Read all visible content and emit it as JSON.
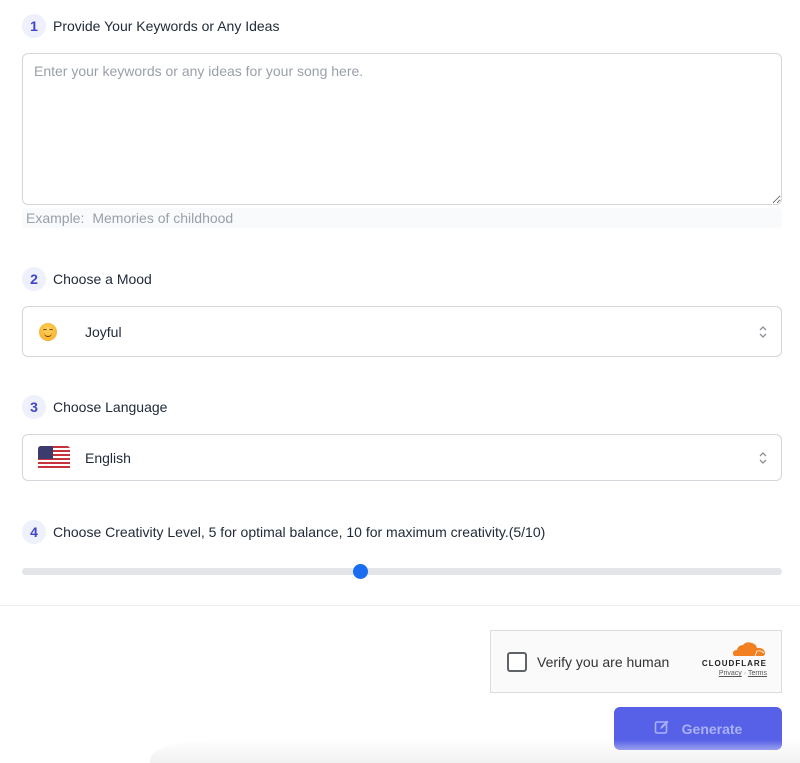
{
  "steps": [
    {
      "number": "1",
      "label": "Provide Your Keywords or Any Ideas"
    },
    {
      "number": "2",
      "label": "Choose a Mood"
    },
    {
      "number": "3",
      "label": "Choose Language"
    },
    {
      "number": "4",
      "label": "Choose Creativity Level, 5 for optimal balance, 10 for maximum creativity.(5/10)"
    }
  ],
  "keywords": {
    "value": "",
    "placeholder": "Enter your keywords or any ideas for your song here.",
    "example_prefix": "Example:",
    "example_value": "Memories of childhood"
  },
  "mood": {
    "icon": "smiling-face-emoji",
    "selected": "Joyful"
  },
  "language": {
    "icon": "us-flag",
    "selected": "English"
  },
  "creativity": {
    "value": 5,
    "min": 0,
    "max": 10,
    "accent": "#1a6cf0"
  },
  "captcha": {
    "label": "Verify you are human",
    "brand": "CLOUDFLARE",
    "privacy": "Privacy",
    "separator": "·",
    "terms": "Terms",
    "brand_color": "#f38020"
  },
  "generate": {
    "label": "Generate",
    "icon": "edit-icon",
    "color": "#5661e8"
  }
}
